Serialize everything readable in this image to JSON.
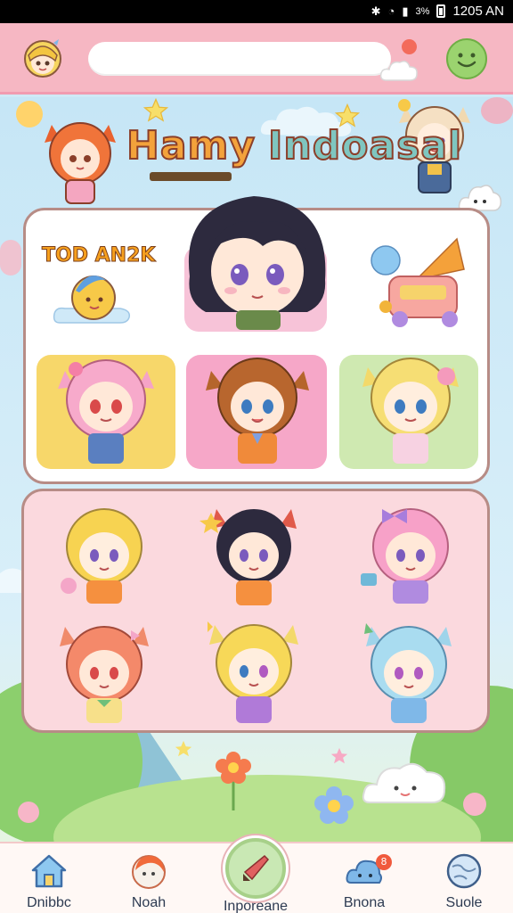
{
  "status_bar": {
    "battery": "3%",
    "time": "1205 AN"
  },
  "header": {
    "search": {
      "placeholder": "",
      "value": ""
    },
    "notification_count": ""
  },
  "title": {
    "word1": "Hamy",
    "word2": "Indoasal"
  },
  "tiles": {
    "top_left_label": "TOD AN2K"
  },
  "nav": {
    "items": [
      {
        "label": "Dnibbc",
        "icon": "house-icon"
      },
      {
        "label": "Noah",
        "icon": "character-icon"
      },
      {
        "label": "Inporeane",
        "icon": "brush-icon"
      },
      {
        "label": "Bnona",
        "icon": "cloud-icon"
      },
      {
        "label": "Suole",
        "icon": "globe-icon"
      }
    ],
    "badge": "8"
  },
  "colors": {
    "header": "#f6b7c3",
    "panel_top": "#ffffff",
    "panel_bottom": "#fbd9de",
    "tile_yellow": "#f7d76a",
    "tile_pink": "#f6a7c8",
    "tile_green": "#cfe9b1",
    "accent_green": "#9bd36f"
  }
}
